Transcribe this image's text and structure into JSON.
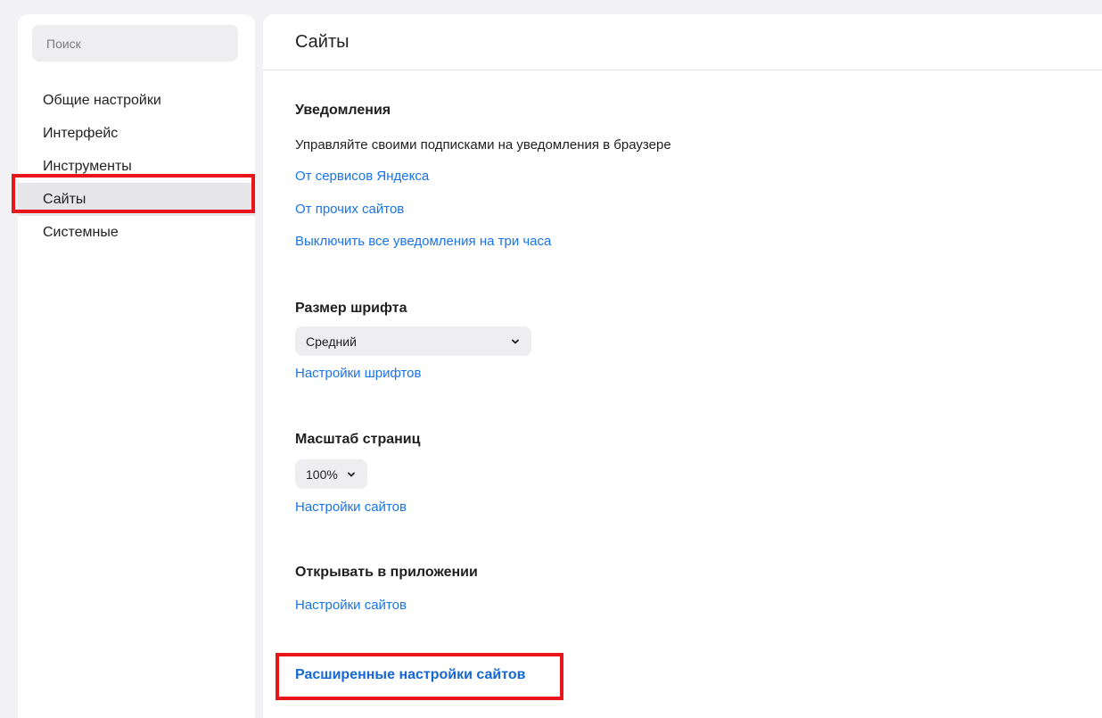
{
  "sidebar": {
    "search": {
      "placeholder": "Поиск",
      "value": ""
    },
    "items": [
      {
        "label": "Общие настройки",
        "active": false
      },
      {
        "label": "Интерфейс",
        "active": false
      },
      {
        "label": "Инструменты",
        "active": false
      },
      {
        "label": "Сайты",
        "active": true
      },
      {
        "label": "Системные",
        "active": false
      }
    ]
  },
  "main": {
    "title": "Сайты",
    "notifications": {
      "title": "Уведомления",
      "description": "Управляйте своими подписками на уведомления в браузере",
      "link_yandex": "От сервисов Яндекса",
      "link_other": "От прочих сайтов",
      "link_disable": "Выключить все уведомления на три часа"
    },
    "font_size": {
      "title": "Размер шрифта",
      "selected": "Средний",
      "link": "Настройки шрифтов"
    },
    "page_zoom": {
      "title": "Масштаб страниц",
      "selected": "100%",
      "link": "Настройки сайтов"
    },
    "open_in_app": {
      "title": "Открывать в приложении",
      "link": "Настройки сайтов"
    },
    "advanced_link": "Расширенные настройки сайтов"
  },
  "colors": {
    "link": "#1a73e8",
    "highlight": "#e8151b",
    "active_item_bg": "#e6e6ea",
    "page_bg": "#f2f2f4"
  },
  "icons": {
    "dropdown": "chevron-down-icon"
  }
}
